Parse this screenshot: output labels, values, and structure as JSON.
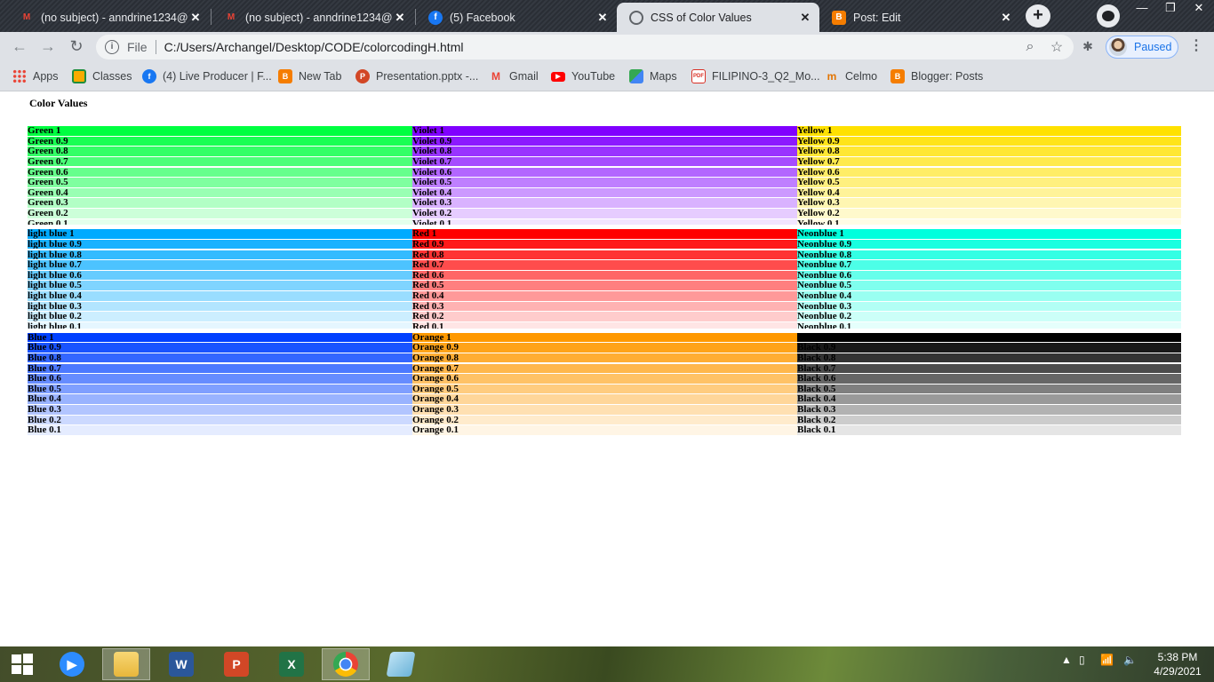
{
  "browser": {
    "tabs": [
      {
        "title": "(no subject) - anndrine1234@g",
        "favicon": "gmail-icon",
        "active": false
      },
      {
        "title": "(no subject) - anndrine1234@g",
        "favicon": "gmail-icon",
        "active": false
      },
      {
        "title": "(5) Facebook",
        "favicon": "facebook-icon",
        "active": false
      },
      {
        "title": "CSS of Color Values",
        "favicon": "globe-icon",
        "active": true
      },
      {
        "title": "Post: Edit",
        "favicon": "blogger-icon",
        "active": false
      }
    ],
    "omnibox": {
      "scheme_label": "File",
      "url": "C:/Users/Archangel/Desktop/CODE/colorcodingH.html"
    },
    "profile_label": "Paused",
    "bookmarks": [
      {
        "label": "Apps",
        "icon": "apps-grid-icon"
      },
      {
        "label": "Classes",
        "icon": "classroom-icon"
      },
      {
        "label": "(4) Live Producer | F...",
        "icon": "facebook-icon"
      },
      {
        "label": "New Tab",
        "icon": "blogger-icon"
      },
      {
        "label": "Presentation.pptx -...",
        "icon": "powerpoint-icon"
      },
      {
        "label": "Gmail",
        "icon": "gmail-icon"
      },
      {
        "label": "YouTube",
        "icon": "youtube-icon"
      },
      {
        "label": "Maps",
        "icon": "maps-icon"
      },
      {
        "label": "FILIPINO-3_Q2_Mo...",
        "icon": "pdf-icon"
      },
      {
        "label": "Celmo",
        "icon": "celmo-icon"
      },
      {
        "label": "Blogger: Posts",
        "icon": "blogger-icon"
      }
    ]
  },
  "page": {
    "title": "Color Values",
    "color_groups": [
      {
        "name": "Green",
        "rgb": "0,255,64",
        "text": "#000000"
      },
      {
        "name": "Violet",
        "rgb": "128,0,255",
        "text": "#000000"
      },
      {
        "name": "Yellow",
        "rgb": "255,225,0",
        "text": "#000000"
      },
      {
        "name": "light blue",
        "rgb": "0,170,255",
        "text": "#000000"
      },
      {
        "name": "Red",
        "rgb": "255,0,0",
        "text": "#000000"
      },
      {
        "name": "Neonblue",
        "rgb": "0,255,221",
        "text": "#000000"
      },
      {
        "name": "Blue",
        "rgb": "0,64,255",
        "text": "#000000"
      },
      {
        "name": "Orange",
        "rgb": "255,153,0",
        "text": "#000000"
      },
      {
        "name": "Black",
        "rgb": "0,0,0",
        "text": "#000000"
      }
    ],
    "alpha_levels": [
      "1",
      "0.9",
      "0.8",
      "0.7",
      "0.6",
      "0.5",
      "0.4",
      "0.3",
      "0.2",
      "0.1"
    ]
  },
  "taskbar": {
    "apps": [
      "start-icon",
      "zoom-icon",
      "file-explorer-icon",
      "word-icon",
      "powerpoint-icon",
      "excel-icon",
      "chrome-icon",
      "notepad-icon"
    ],
    "active_app": "chrome-icon",
    "time": "5:38 PM",
    "date": "4/29/2021"
  }
}
